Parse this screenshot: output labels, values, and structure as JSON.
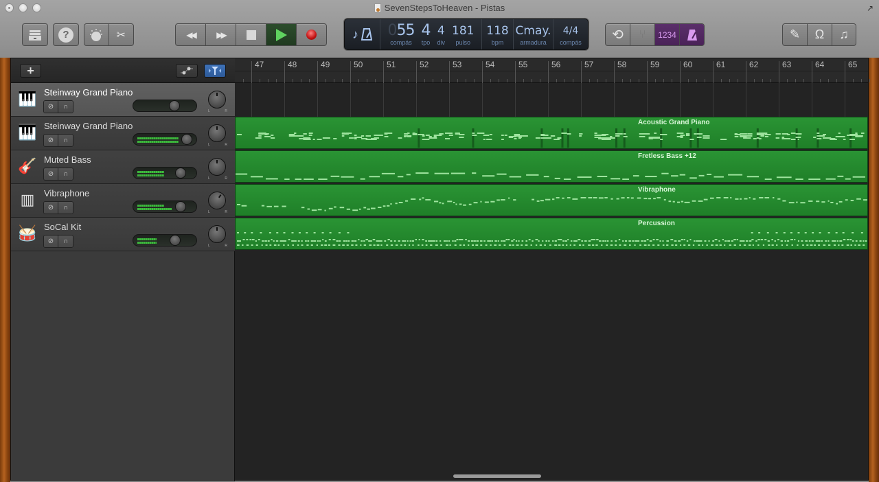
{
  "window": {
    "title": "SevenStepsToHeaven - Pistas",
    "buttons": {
      "close": "close",
      "minimize": "minimize",
      "zoom": "zoom",
      "fullscreen_icon": "↗"
    }
  },
  "toolbar": {
    "left": [
      {
        "name": "library-button",
        "icon": "library-icon"
      },
      {
        "name": "help-button",
        "icon": "help-icon",
        "glyph": "?"
      },
      {
        "name": "smart-controls-button",
        "icon": "smart-controls-icon"
      },
      {
        "name": "editors-button",
        "icon": "scissors-icon",
        "glyph": "✂"
      }
    ],
    "transport": [
      {
        "name": "rewind-button",
        "glyph": "◀◀"
      },
      {
        "name": "fast-forward-button",
        "glyph": "▶▶"
      },
      {
        "name": "stop-button"
      },
      {
        "name": "play-button",
        "active": true
      },
      {
        "name": "record-button"
      }
    ],
    "right_group1": [
      {
        "name": "cycle-button",
        "glyph": "⟲"
      },
      {
        "name": "tuner-button",
        "glyph": "⑂"
      },
      {
        "name": "count-in-button",
        "glyph": "1234",
        "active": true
      },
      {
        "name": "metronome-button",
        "active": true
      }
    ],
    "right_group2": [
      {
        "name": "notepad-button",
        "glyph": "✎"
      },
      {
        "name": "loop-browser-button",
        "glyph": "Ω"
      },
      {
        "name": "media-browser-button",
        "glyph": "♫"
      }
    ]
  },
  "lcd": {
    "bar_ghost": "0",
    "bar": "55",
    "beat": "4",
    "division": "4",
    "tick": "181",
    "tempo": "118",
    "key": "Cmay.",
    "time_signature": "4/4",
    "labels": {
      "bar": "compás",
      "beat": "tpo",
      "division": "div",
      "tick": "pulso",
      "tempo": "bpm",
      "key": "armadura",
      "time_signature": "compás"
    }
  },
  "track_header": {
    "add_label": "+",
    "automation_icon": "automation-icon",
    "filter_icon": "catch-playhead-icon"
  },
  "tracks": [
    {
      "name": "Steinway Grand Piano",
      "icon": "🎹",
      "selected": true,
      "volume": 0.68,
      "meter": 0,
      "pan": 0
    },
    {
      "name": "Steinway Grand Piano",
      "icon": "🎹",
      "selected": false,
      "volume": 0.92,
      "meter": 0.85,
      "pan": 0
    },
    {
      "name": "Muted Bass",
      "icon": "🎸",
      "selected": false,
      "volume": 0.8,
      "meter": 0.55,
      "pan": 0
    },
    {
      "name": "Vibraphone",
      "icon": "▥",
      "selected": false,
      "volume": 0.8,
      "meter": 0.55,
      "pan": 0.25
    },
    {
      "name": "SoCal Kit",
      "icon": "🥁",
      "selected": false,
      "volume": 0.7,
      "meter": 0.4,
      "pan": 0
    }
  ],
  "ruler": {
    "bars": [
      "47",
      "48",
      "49",
      "50",
      "51",
      "52",
      "53",
      "54",
      "55",
      "56",
      "57",
      "58",
      "59",
      "60",
      "61",
      "62",
      "63",
      "64",
      "65"
    ]
  },
  "regions": [
    null,
    {
      "label": "Acoustic Grand Piano",
      "style": "piano"
    },
    {
      "label": "Fretless Bass   +12",
      "style": "bass"
    },
    {
      "label": "Vibraphone",
      "style": "vibe"
    },
    {
      "label": "Percussion",
      "style": "perc"
    }
  ],
  "mute_glyph": "⊘",
  "solo_glyph": "∩",
  "pan_l": "L",
  "pan_r": "R"
}
